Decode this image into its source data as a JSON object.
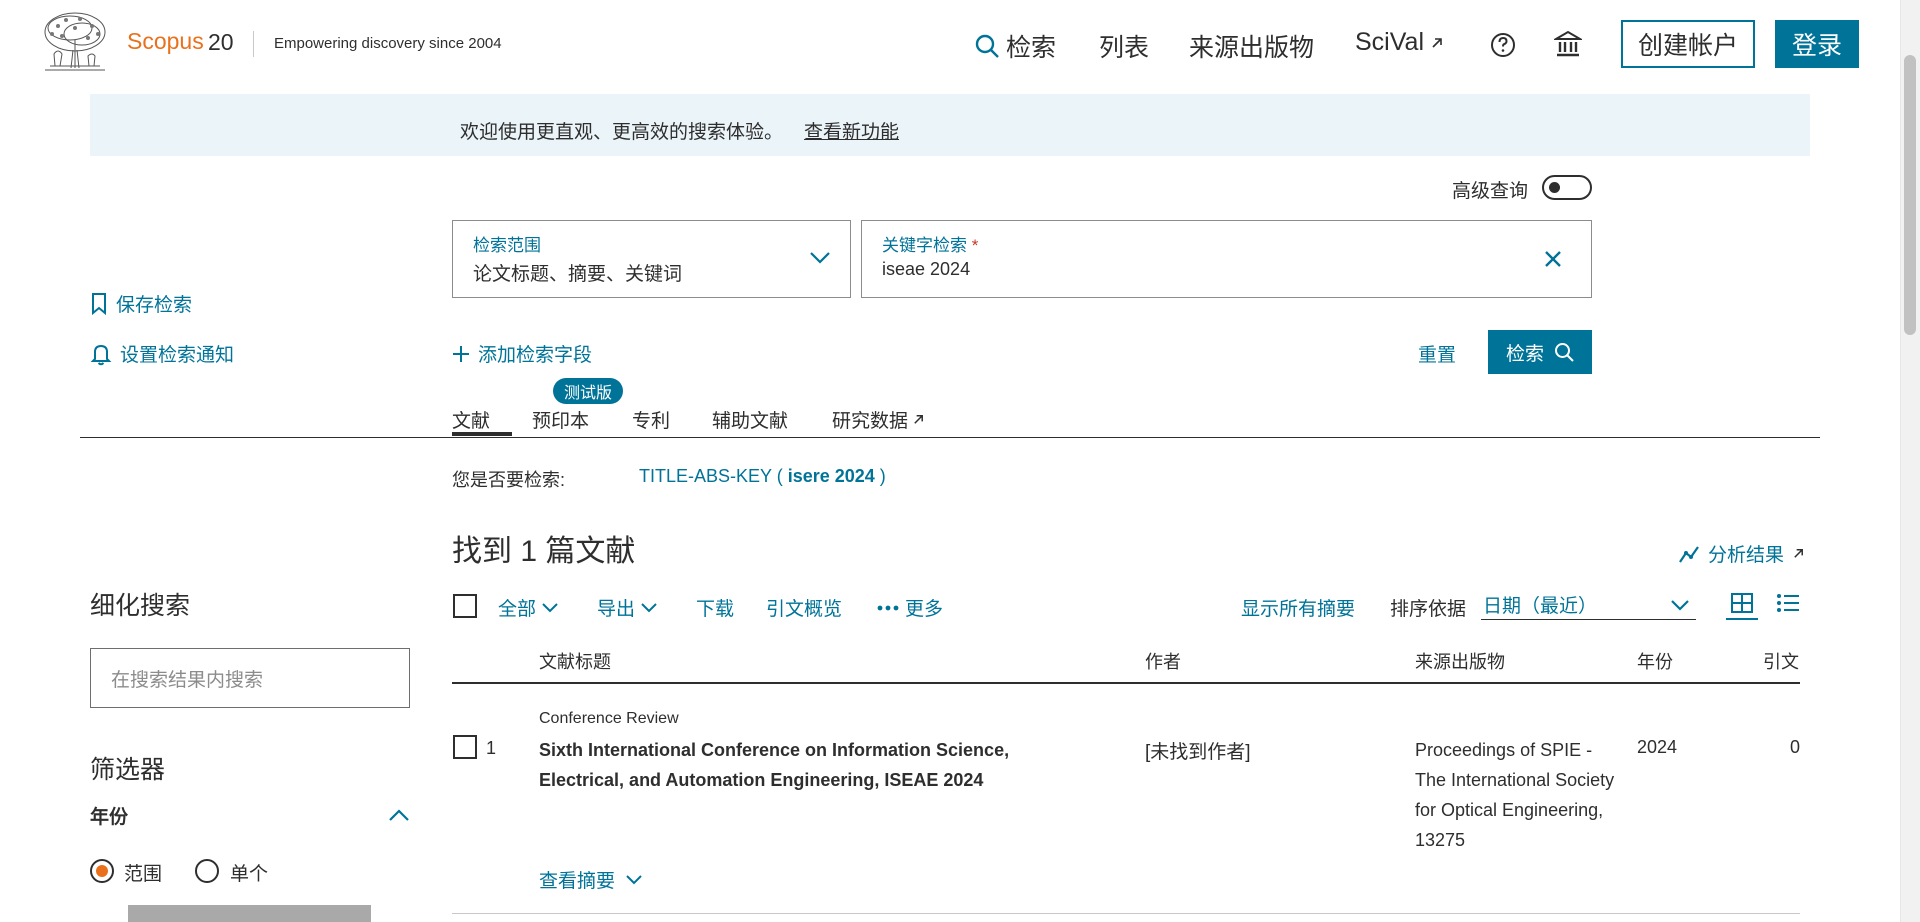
{
  "header": {
    "brand": "Scopus",
    "brand_version": "20",
    "tagline": "Empowering discovery since 2004",
    "nav": {
      "search": "检索",
      "lists": "列表",
      "sources": "来源出版物",
      "scival": "SciVal"
    },
    "create_account": "创建帐户",
    "login": "登录"
  },
  "banner": {
    "text": "欢迎使用更直观、更高效的搜索体验。",
    "link": "查看新功能"
  },
  "advanced": {
    "label": "高级查询"
  },
  "search": {
    "scope_label": "检索范围",
    "scope_value": "论文标题、摘要、关键词",
    "keyword_label": "关键字检索",
    "keyword_required": "*",
    "keyword_value": "iseae 2024",
    "add_field": "添加检索字段",
    "reset": "重置",
    "submit": "检索"
  },
  "left_actions": {
    "save_search": "保存检索",
    "set_alert": "设置检索通知"
  },
  "tabs": {
    "documents": "文献",
    "preprints": "预印本",
    "beta": "测试版",
    "patents": "专利",
    "secondary": "辅助文献",
    "research_data": "研究数据"
  },
  "did_you_mean": {
    "label": "您是否要检索:",
    "prefix": "TITLE-ABS-KEY ( ",
    "term": "isere 2024",
    "suffix": " )"
  },
  "results": {
    "title": "找到 1 篇文献",
    "analyze": "分析结果"
  },
  "refine": {
    "title": "细化搜索",
    "placeholder": "在搜索结果内搜索",
    "filters_title": "筛选器",
    "year_title": "年份",
    "range": "范围",
    "single": "单个"
  },
  "toolbar": {
    "all": "全部",
    "export": "导出",
    "download": "下载",
    "citation_overview": "引文概览",
    "more": "更多",
    "show_abstracts": "显示所有摘要",
    "sort_label": "排序依据",
    "sort_value": "日期（最近）"
  },
  "table": {
    "headers": {
      "title": "文献标题",
      "author": "作者",
      "source": "来源出版物",
      "year": "年份",
      "citations": "引文"
    },
    "rows": [
      {
        "num": "1",
        "type": "Conference Review",
        "title": "Sixth International Conference on Information Science, Electrical, and Automation Engineering, ISEAE 2024",
        "author": "[未找到作者]",
        "source": "Proceedings of SPIE - The International Society for Optical Engineering, 13275",
        "year": "2024",
        "citations": "0",
        "view_abstract": "查看摘要"
      }
    ]
  },
  "colors": {
    "accent": "#007398",
    "brand": "#e9711c",
    "banner_bg": "#ebf4f8"
  }
}
